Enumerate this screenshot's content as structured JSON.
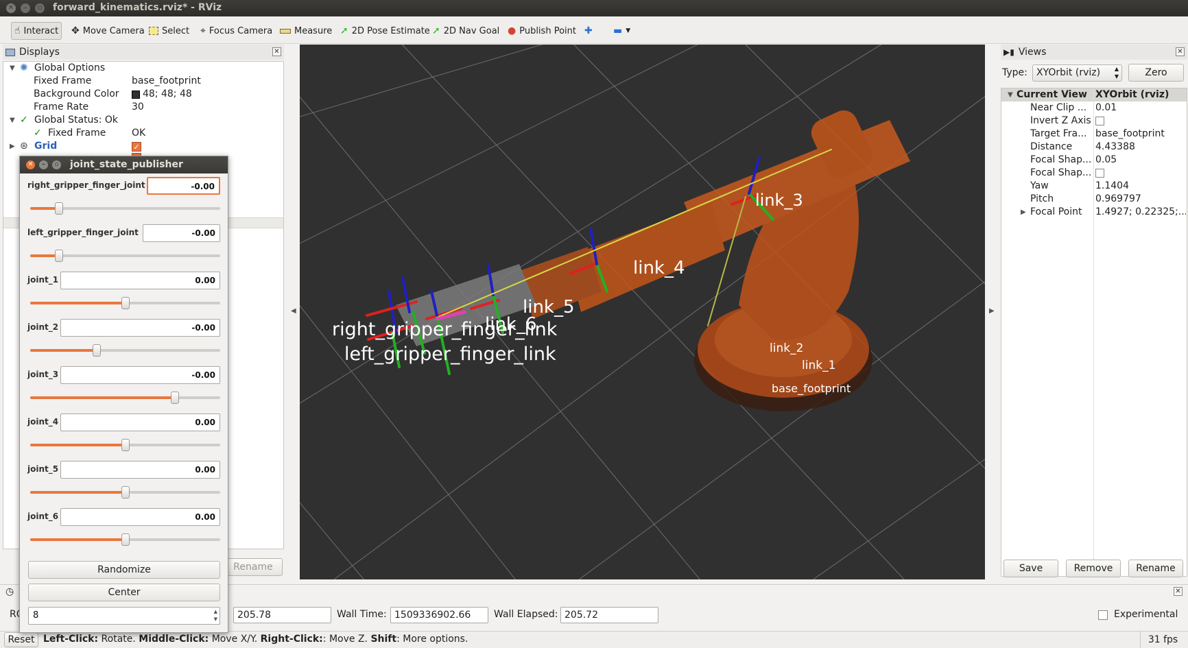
{
  "window": {
    "title": "forward_kinematics.rviz* - RViz"
  },
  "toolbar": {
    "interact": "Interact",
    "move_camera": "Move Camera",
    "select": "Select",
    "focus_camera": "Focus Camera",
    "measure": "Measure",
    "pose_estimate": "2D Pose Estimate",
    "nav_goal": "2D Nav Goal",
    "publish_point": "Publish Point"
  },
  "displays": {
    "title": "Displays",
    "rows": {
      "global_options": "Global Options",
      "fixed_frame_key": "Fixed Frame",
      "fixed_frame_val": "base_footprint",
      "bg_color_key": "Background Color",
      "bg_color_val": "48; 48; 48",
      "frame_rate_key": "Frame Rate",
      "frame_rate_val": "30",
      "global_status": "Global Status: Ok",
      "status_fixed_frame_key": "Fixed Frame",
      "status_fixed_frame_val": "OK",
      "grid": "Grid"
    },
    "rename": "Rename"
  },
  "jsp": {
    "title": "joint_state_publisher",
    "joints": [
      {
        "name": "right_gripper_finger_joint",
        "value": "-0.00",
        "pos": 0.15
      },
      {
        "name": "left_gripper_finger_joint",
        "value": "-0.00",
        "pos": 0.15
      },
      {
        "name": "joint_1",
        "value": "0.00",
        "pos": 0.5
      },
      {
        "name": "joint_2",
        "value": "-0.00",
        "pos": 0.35
      },
      {
        "name": "joint_3",
        "value": "-0.00",
        "pos": 0.76
      },
      {
        "name": "joint_4",
        "value": "0.00",
        "pos": 0.5
      },
      {
        "name": "joint_5",
        "value": "0.00",
        "pos": 0.5
      },
      {
        "name": "joint_6",
        "value": "0.00",
        "pos": 0.5
      }
    ],
    "randomize": "Randomize",
    "center": "Center",
    "spin_value": "8"
  },
  "viewport": {
    "labels": {
      "link_3": "link_3",
      "link_4": "link_4",
      "link_5": "link_5",
      "link_6": "link_6",
      "right_gripper": "right_gripper_finger_link",
      "left_gripper": "left_gripper_finger_link",
      "link_2": "link_2",
      "link_1": "link_1",
      "base": "base_footprint"
    }
  },
  "views": {
    "title": "Views",
    "type_label": "Type:",
    "type_value": "XYOrbit (rviz)",
    "zero": "Zero",
    "current_view_key": "Current View",
    "current_view_val": "XYOrbit (rviz)",
    "props": [
      {
        "k": "Near Clip ...",
        "v": "0.01"
      },
      {
        "k": "Invert Z Axis",
        "v": ""
      },
      {
        "k": "Target Fra...",
        "v": "base_footprint"
      },
      {
        "k": "Distance",
        "v": "4.43388"
      },
      {
        "k": "Focal Shap...",
        "v": "0.05"
      },
      {
        "k": "Focal Shap...",
        "v": ""
      },
      {
        "k": "Yaw",
        "v": "1.1404"
      },
      {
        "k": "Pitch",
        "v": "0.969797"
      },
      {
        "k": "Focal Point",
        "v": "1.4927; 0.22325;..."
      }
    ],
    "save": "Save",
    "remove": "Remove",
    "rename": "Rename"
  },
  "time": {
    "ros_label": "RO",
    "ros_elapsed_val": "205.78",
    "wall_time_label": "Wall Time:",
    "wall_time_val": "1509336902.66",
    "wall_elapsed_label": "Wall Elapsed:",
    "wall_elapsed_val": "205.72",
    "experimental": "Experimental"
  },
  "status": {
    "reset": "Reset",
    "hint_b1": "Left-Click:",
    "hint_t1": " Rotate. ",
    "hint_b2": "Middle-Click:",
    "hint_t2": " Move X/Y. ",
    "hint_b3": "Right-Click:",
    "hint_t3": ": Move Z. ",
    "hint_b4": "Shift",
    "hint_t4": ": More options.",
    "fps": "31 fps"
  }
}
